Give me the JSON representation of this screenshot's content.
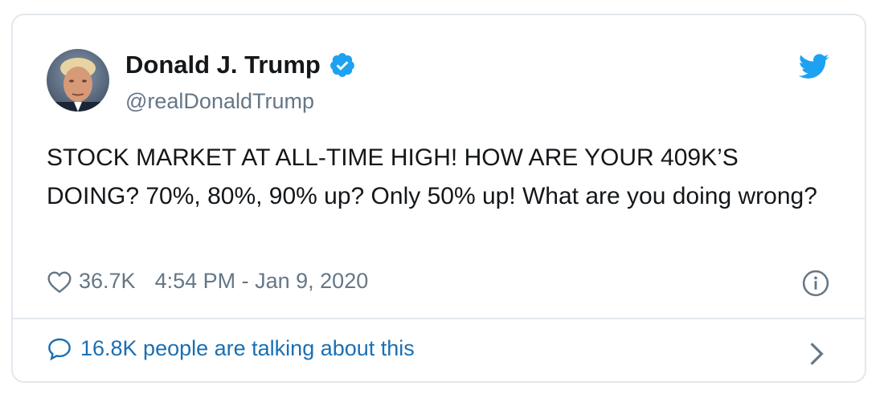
{
  "user": {
    "name": "Donald J. Trump",
    "handle": "@realDonaldTrump"
  },
  "tweet": {
    "text": "STOCK MARKET AT ALL-TIME HIGH! HOW ARE YOUR 409K’S DOING? 70%, 80%, 90% up? Only 50% up! What are you doing wrong?",
    "likes": "36.7K",
    "timestamp": "4:54 PM - Jan 9, 2020"
  },
  "conversation": {
    "text": "16.8K people are talking about this"
  },
  "colors": {
    "twitter_blue": "#1da1f2",
    "link_blue": "#1b6fb3",
    "text_dark": "#14171a",
    "text_gray": "#657786",
    "border": "#e1e8ed"
  },
  "icons": [
    "avatar",
    "verified-badge-icon",
    "twitter-bird-icon",
    "heart-icon",
    "info-icon",
    "speech-bubble-icon",
    "chevron-right-icon"
  ]
}
